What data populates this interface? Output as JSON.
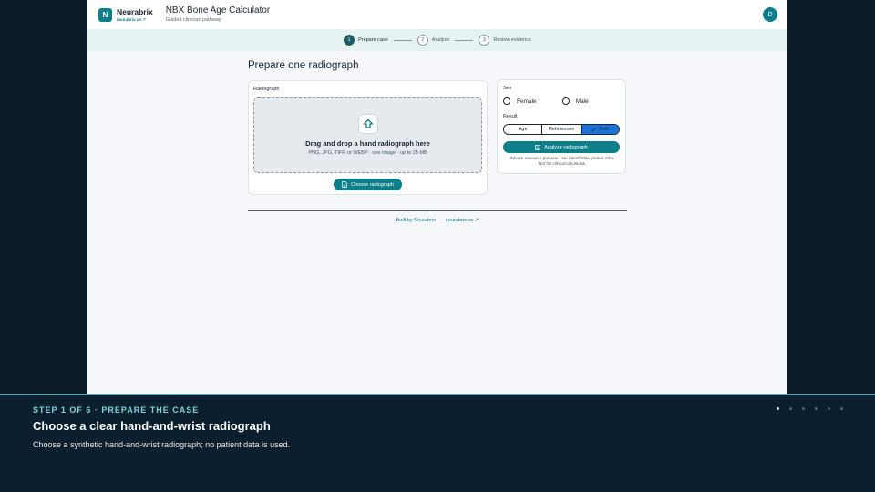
{
  "header": {
    "logo_letter": "N",
    "brand_name": "Neurabrix",
    "brand_link": "neurabrix.co ↗",
    "app_title": "NBX Bone Age Calculator",
    "app_subtitle": "Guided clinician pathway",
    "avatar_letter": "D"
  },
  "stepper": {
    "steps": [
      {
        "num": "1",
        "label": "Prepare case",
        "active": true
      },
      {
        "num": "2",
        "label": "Analyze",
        "active": false
      },
      {
        "num": "3",
        "label": "Review evidence",
        "active": false
      }
    ]
  },
  "main": {
    "page_title": "Prepare one radiograph",
    "upload": {
      "label": "Radiograph",
      "title": "Drag and drop a hand radiograph here",
      "hint": "PNG, JPG, TIFF, or WEBP · one image · up to 25 MB",
      "choose_label": "Choose radiograph"
    },
    "options": {
      "sex_label": "Sex",
      "sex_options": [
        "Female",
        "Male"
      ],
      "result_label": "Result",
      "result_options": [
        "Age",
        "References",
        "Both"
      ],
      "result_selected": "Both",
      "analyze_label": "Analyze radiograph",
      "disclaimer_line1": "Private research preview · No identifiable patient data.",
      "disclaimer_line2": "Not for clinical decisions."
    }
  },
  "footer": {
    "built_by": "Built by Neurabrix",
    "separator": "·",
    "link": "neurabrix.co ↗"
  },
  "tutorial": {
    "step_text": "STEP 1 OF 6 · PREPARE THE CASE",
    "title": "Choose a clear hand-and-wrist radiograph",
    "description": "Choose a synthetic hand-and-wrist radiograph; no patient data is used.",
    "total_steps": 6,
    "current_step": 1
  },
  "colors": {
    "brand": "#0d7f8a",
    "selected_segment": "#1a73d9",
    "tutorial_bg": "#0b1f2e",
    "tutorial_accent": "#7fd6d8"
  }
}
